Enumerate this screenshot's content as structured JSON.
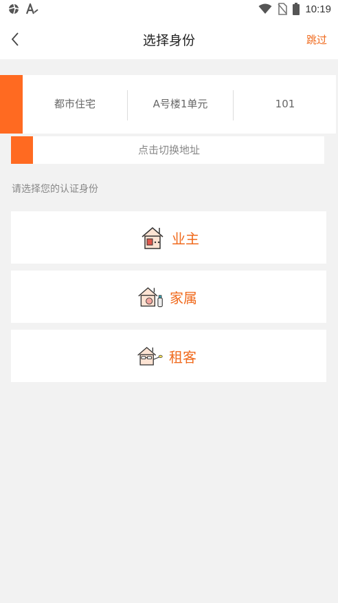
{
  "status_bar": {
    "time": "10:19",
    "icons": [
      "app-icon",
      "a-icon",
      "wifi-icon",
      "no-sim-icon",
      "battery-icon"
    ]
  },
  "header": {
    "title": "选择身份",
    "skip_label": "跳过",
    "back_icon": "chevron-left-icon"
  },
  "address": {
    "community": "都市住宅",
    "building": "A号楼1单元",
    "room": "101"
  },
  "switch_address": {
    "label": "点击切换地址"
  },
  "section": {
    "label": "请选择您的认证身份"
  },
  "roles": [
    {
      "label": "业主",
      "icon": "owner-house-icon"
    },
    {
      "label": "家属",
      "icon": "family-house-icon"
    },
    {
      "label": "租客",
      "icon": "tenant-house-icon"
    }
  ],
  "colors": {
    "accent": "#ff6a21",
    "accent_text": "#f06a1d",
    "background": "#f2f2f2"
  }
}
